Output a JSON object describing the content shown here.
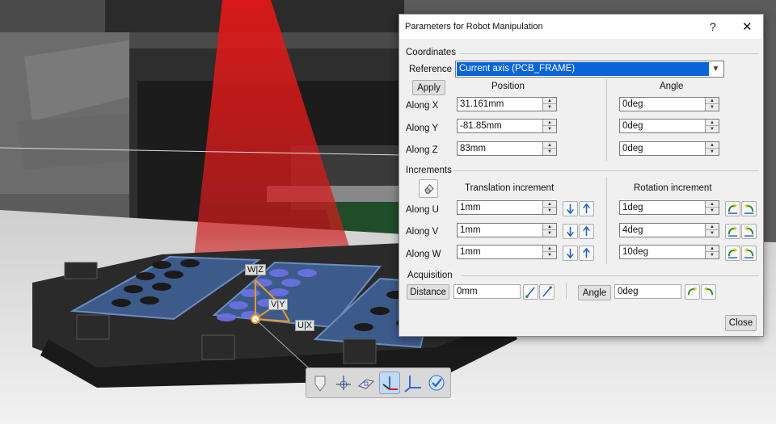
{
  "dialog": {
    "title": "Parameters for Robot Manipulation",
    "help_label": "?",
    "close_glyph": "✕",
    "coordinates": {
      "section_label": "Coordinates",
      "reference_label": "Reference",
      "reference_value": "Current axis (PCB_FRAME)",
      "apply_label": "Apply",
      "position_header": "Position",
      "angle_header": "Angle",
      "rows": [
        {
          "label": "Along X",
          "position": "31.161mm",
          "angle": "0deg"
        },
        {
          "label": "Along Y",
          "position": "-81.85mm",
          "angle": "0deg"
        },
        {
          "label": "Along Z",
          "position": "83mm",
          "angle": "0deg"
        }
      ]
    },
    "increments": {
      "section_label": "Increments",
      "translation_header": "Translation increment",
      "rotation_header": "Rotation increment",
      "rows": [
        {
          "label": "Along U",
          "translation": "1mm",
          "rotation": "1deg"
        },
        {
          "label": "Along V",
          "translation": "1mm",
          "rotation": "4deg"
        },
        {
          "label": "Along W",
          "translation": "1mm",
          "rotation": "10deg"
        }
      ]
    },
    "acquisition": {
      "section_label": "Acquisition",
      "distance_label": "Distance",
      "distance_value": "0mm",
      "angle_label": "Angle",
      "angle_value": "0deg"
    },
    "close_label": "Close"
  },
  "scene": {
    "axis_labels": {
      "w": "W|Z",
      "v": "V|Y",
      "u": "U|X"
    },
    "colors": {
      "laser": "#e01818",
      "axis_orange": "#f29a1c",
      "tray_blue": "#3c5a8a",
      "fixture": "#2a2a2a"
    }
  },
  "toolbar": {
    "icons": [
      "drop-icon",
      "move-axis-icon",
      "plane-icon",
      "compass-active-icon",
      "axis-system-icon",
      "confirm-check-icon"
    ]
  }
}
